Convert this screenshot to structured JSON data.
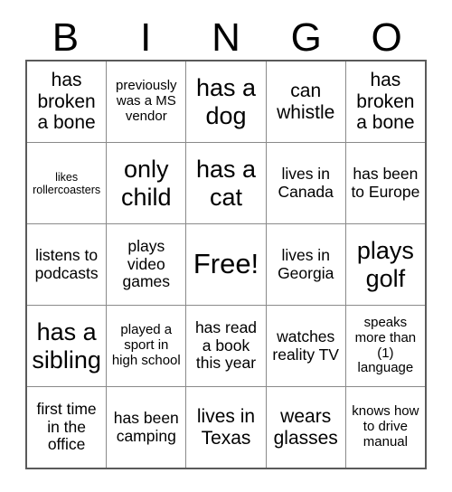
{
  "header": {
    "letters": [
      "B",
      "I",
      "N",
      "G",
      "O"
    ]
  },
  "grid": {
    "columns": 5,
    "rows": 5,
    "border_color": "#5a5a5a",
    "gridline_color": "#8a8a8a",
    "cell_background": "#ffffff",
    "text_color": "#000000",
    "cells": [
      {
        "text": "has broken a bone",
        "size": "l"
      },
      {
        "text": "previously was a MS vendor",
        "size": "s"
      },
      {
        "text": "has a dog",
        "size": "xl"
      },
      {
        "text": "can whistle",
        "size": "l"
      },
      {
        "text": "has broken a bone",
        "size": "l"
      },
      {
        "text": "likes rollercoasters",
        "size": "xs"
      },
      {
        "text": "only child",
        "size": "xl"
      },
      {
        "text": "has a cat",
        "size": "xl"
      },
      {
        "text": "lives in Canada",
        "size": "m"
      },
      {
        "text": "has been to Europe",
        "size": "m"
      },
      {
        "text": "listens to podcasts",
        "size": "m"
      },
      {
        "text": "plays video games",
        "size": "m"
      },
      {
        "text": "Free!",
        "size": "xxl"
      },
      {
        "text": "lives in Georgia",
        "size": "m"
      },
      {
        "text": "plays golf",
        "size": "xl"
      },
      {
        "text": "has a sibling",
        "size": "xl"
      },
      {
        "text": "played a sport in high school",
        "size": "s"
      },
      {
        "text": "has read a book this year",
        "size": "m"
      },
      {
        "text": "watches reality TV",
        "size": "m"
      },
      {
        "text": "speaks more than (1) language",
        "size": "s"
      },
      {
        "text": "first time in the office",
        "size": "m"
      },
      {
        "text": "has been camping",
        "size": "m"
      },
      {
        "text": "lives in Texas",
        "size": "l"
      },
      {
        "text": "wears glasses",
        "size": "l"
      },
      {
        "text": "knows how to drive manual",
        "size": "s"
      }
    ]
  }
}
